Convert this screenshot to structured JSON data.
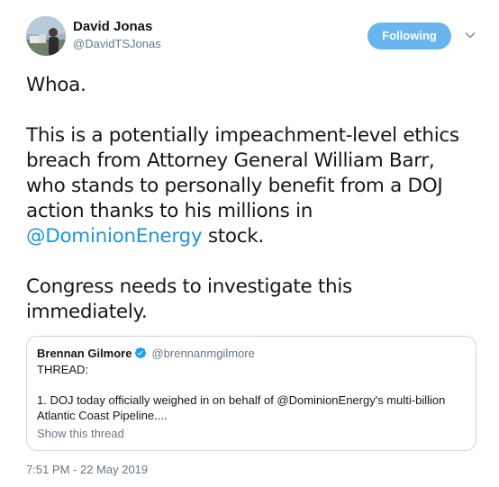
{
  "author": {
    "name": "David Jonas",
    "handle": "@DavidTSJonas"
  },
  "follow_button": {
    "label": "Following"
  },
  "tweet": {
    "para1": "Whoa.",
    "para2_lines": [
      "This is a potentially impeachment-level ethics",
      "breach from Attorney General William Barr,",
      "who stands to personally benefit from a DOJ",
      "action thanks to his millions in"
    ],
    "para2_mention": "@DominionEnergy",
    "para2_tail": " stock.",
    "para3_lines": [
      "Congress needs to investigate this",
      "immediately."
    ]
  },
  "quoted": {
    "name": "Brennan Gilmore",
    "handle": "@brennanmgilmore",
    "line1": "THREAD:",
    "line2": "1. DOJ today officially weighed in on behalf of @DominionEnergy's multi-billion",
    "line3": "Atlantic Coast Pipeline....",
    "show_thread": "Show this thread"
  },
  "timestamp": "7:51 PM - 22 May 2019",
  "colors": {
    "follow_bg": "#69b6ee",
    "mention": "#1b95e0",
    "secondary_text": "#657786",
    "verified": "#1da1f2",
    "border": "#ccd6dd"
  },
  "icons": {
    "verified": "verified-badge-icon",
    "chevron": "chevron-down-icon"
  }
}
